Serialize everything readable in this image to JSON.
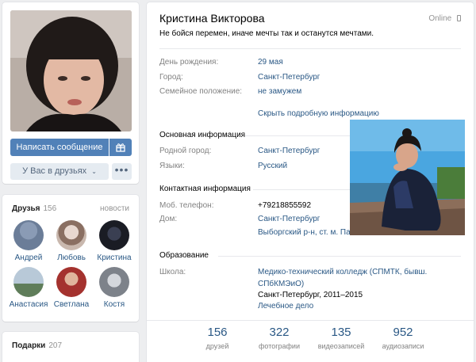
{
  "profile": {
    "name": "Кристина Викторова",
    "online": "Online",
    "status": "Не бойся перемен, иначе мечты так и останутся мечтами."
  },
  "actions": {
    "message_label": "Написать сообщение",
    "friends_label": "У Вас в друзьях",
    "more_label": "•••"
  },
  "info_short": [
    {
      "label": "День рождения:",
      "value": "29 мая"
    },
    {
      "label": "Город:",
      "value": "Санкт-Петербург"
    },
    {
      "label": "Семейное положение:",
      "value": "не замужем"
    }
  ],
  "show_more": "Скрыть подробную информацию",
  "sections": {
    "main_title": "Основная информация",
    "main": [
      {
        "label": "Родной город:",
        "value": "Санкт-Петербург"
      },
      {
        "label": "Языки:",
        "value": "Русский"
      }
    ],
    "contact_title": "Контактная информация",
    "contact": [
      {
        "label": "Моб. телефон:",
        "value": "+79218855592"
      },
      {
        "label": "Дом:",
        "value": "Санкт-Петербург",
        "value2": "Выборгский р-н, ст. м. Па"
      }
    ],
    "edu_title": "Образование",
    "edu": {
      "label": "Школа:",
      "line1": "Медико-технический колледж (СПМТК, бывш.",
      "line2": "СПбКМЭиО)",
      "line3": "Санкт-Петербург, 2011–2015",
      "line4": "Лечебное дело"
    }
  },
  "counters": [
    {
      "num": "156",
      "label": "друзей"
    },
    {
      "num": "322",
      "label": "фотографии"
    },
    {
      "num": "135",
      "label": "видеозаписей"
    },
    {
      "num": "952",
      "label": "аудиозаписи"
    }
  ],
  "friends_block": {
    "title": "Друзья",
    "count": "156",
    "link": "новости",
    "items": [
      {
        "name": "Андрей"
      },
      {
        "name": "Любовь"
      },
      {
        "name": "Кристина"
      },
      {
        "name": "Анастасия"
      },
      {
        "name": "Светлана"
      },
      {
        "name": "Костя"
      }
    ]
  },
  "gifts_block": {
    "title": "Подарки",
    "count": "207"
  },
  "colors": {
    "accent": "#5181b8",
    "link": "#2a5885",
    "background": "#edeef0"
  }
}
